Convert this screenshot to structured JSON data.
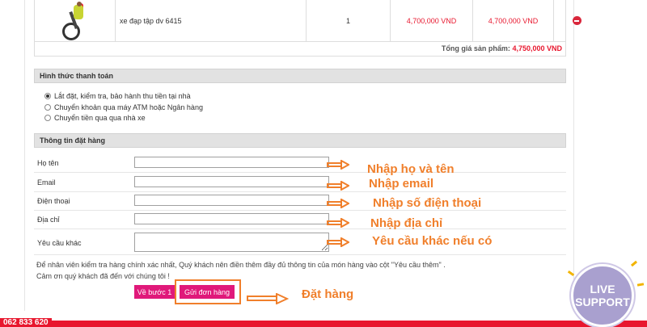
{
  "cart": {
    "product_name": "xe đạp tập dv 6415",
    "quantity": "1",
    "unit_price": "4,700,000 VND",
    "line_total": "4,700,000 VND",
    "subtotal_label": "Tổng giá sản phẩm:",
    "subtotal_value": "4,750,000 VND"
  },
  "payment": {
    "title": "Hình thức thanh toán",
    "options": [
      {
        "label": "Lắt đặt, kiểm tra, bảo hành thu tiền tại nhà",
        "checked": true
      },
      {
        "label": "Chuyển khoản qua máy ATM hoặc Ngân hàng",
        "checked": false
      },
      {
        "label": "Chuyển tiền qua qua nhà xe",
        "checked": false
      }
    ]
  },
  "order_info": {
    "title": "Thông tin đặt hàng",
    "fields": [
      {
        "label": "Họ tên",
        "value": ""
      },
      {
        "label": "Email",
        "value": ""
      },
      {
        "label": "Điện thoại",
        "value": ""
      },
      {
        "label": "Địa chỉ",
        "value": ""
      },
      {
        "label": "Yêu cầu khác",
        "value": ""
      }
    ],
    "note_line1": "Để nhân viên kiểm tra hàng chính xác nhất, Quý khách nên điền thêm đầy đủ thông tin của món hàng vào cột \"Yêu cầu thêm\" .",
    "note_line2": "Cảm ơn quý khách đã đến với chúng tôi !"
  },
  "buttons": {
    "back": "Về bước 1",
    "submit": "Gửi đơn hàng"
  },
  "annotations": {
    "name": "Nhập họ và tên",
    "email": "Nhập email",
    "phone": "Nhập số điện thoại",
    "address": "Nhập địa chỉ",
    "other": "Yêu cầu khác nếu có",
    "submit": "Đặt hàng"
  },
  "footer": {
    "phone": "062 833 620"
  },
  "live_support": {
    "line1": "LIVE",
    "line2": "SUPPORT"
  },
  "colors": {
    "accent_red": "#e8172e",
    "button_pink": "#e0197a",
    "annotation_orange": "#f07f2b",
    "support_purple": "#a9a0cf"
  }
}
